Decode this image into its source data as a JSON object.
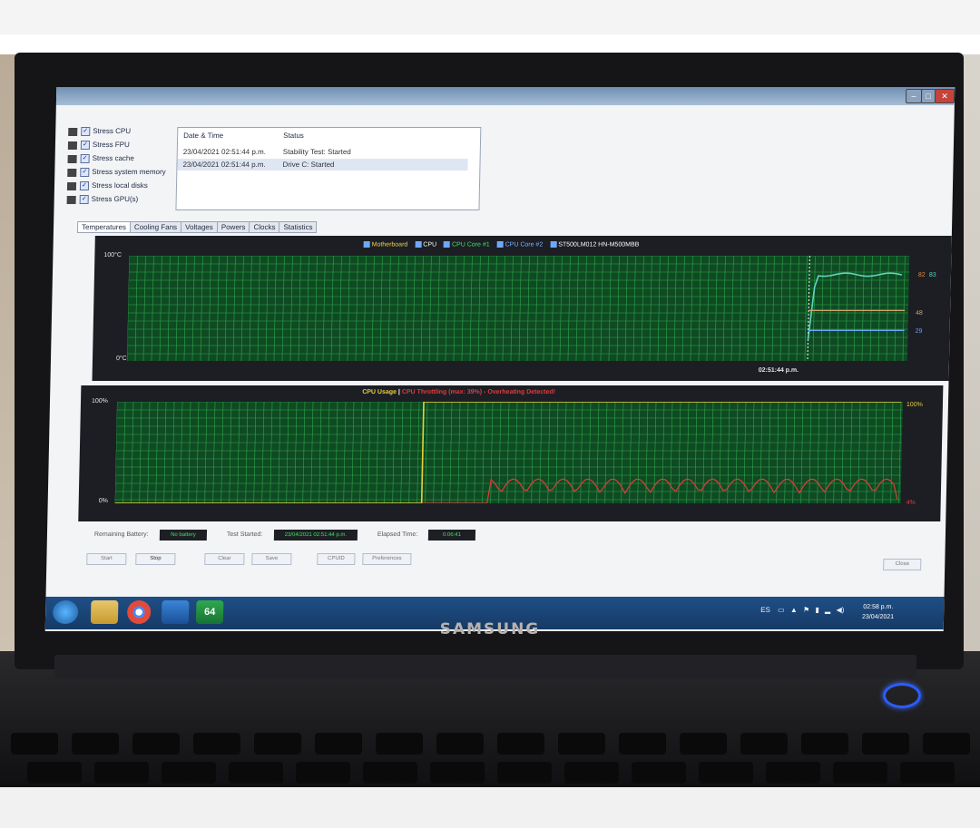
{
  "options": [
    {
      "label": "Stress CPU",
      "checked": true,
      "icon": "cpu-icon"
    },
    {
      "label": "Stress FPU",
      "checked": true,
      "icon": "fpu-icon"
    },
    {
      "label": "Stress cache",
      "checked": true,
      "icon": "cache-icon"
    },
    {
      "label": "Stress system memory",
      "checked": true,
      "icon": "memory-icon"
    },
    {
      "label": "Stress local disks",
      "checked": true,
      "icon": "disk-icon"
    },
    {
      "label": "Stress GPU(s)",
      "checked": true,
      "icon": "gpu-icon"
    }
  ],
  "log": {
    "headers": [
      "Date & Time",
      "Status"
    ],
    "rows": [
      {
        "time": "23/04/2021 02:51:44 p.m.",
        "status": "Stability Test: Started"
      },
      {
        "time": "23/04/2021 02:51:44 p.m.",
        "status": "Drive C: Started"
      }
    ]
  },
  "tabs": [
    "Temperatures",
    "Cooling Fans",
    "Voltages",
    "Powers",
    "Clocks",
    "Statistics"
  ],
  "temp_chart": {
    "legend": [
      "Motherboard",
      "CPU",
      "CPU Core #1",
      "CPU Core #2",
      "ST500LM012 HN-M500MBB"
    ],
    "y_top": "100°C",
    "y_bottom": "0°C",
    "x_marker": "02:51:44 p.m.",
    "end_values": [
      "82",
      "83",
      "48",
      "29"
    ],
    "colors": {
      "core": "#5fd3c2",
      "cpu": "#caa46b",
      "disk": "#6aa8ff"
    }
  },
  "usage_chart": {
    "title_left": "CPU Usage",
    "separator": "|",
    "title_right": "CPU Throttling (max: 39%) - Overheating Detected!",
    "y_top": "100%",
    "y_bottom": "0%",
    "end_usage": "100%",
    "end_throttle": "4%",
    "colors": {
      "usage": "#e6d23a",
      "throttle": "#e23b3b"
    }
  },
  "status": {
    "battery_label": "Remaining Battery:",
    "battery_value": "No battery",
    "started_label": "Test Started:",
    "started_value": "23/04/2021 02:51:44 p.m.",
    "elapsed_label": "Elapsed Time:",
    "elapsed_value": "0:06:41"
  },
  "buttons": [
    "Start",
    "Stop",
    "Clear",
    "Save",
    "CPUID",
    "Preferences",
    "Close"
  ],
  "taskbar": {
    "lang": "ES",
    "clock_time": "02:58 p.m.",
    "clock_date": "23/04/2021",
    "apps": [
      "start-orb-icon",
      "file-explorer-icon",
      "chrome-icon",
      "media-player-icon",
      "aida64-icon"
    ],
    "active_app_text": "64"
  },
  "brand": "SAMSUNG"
}
